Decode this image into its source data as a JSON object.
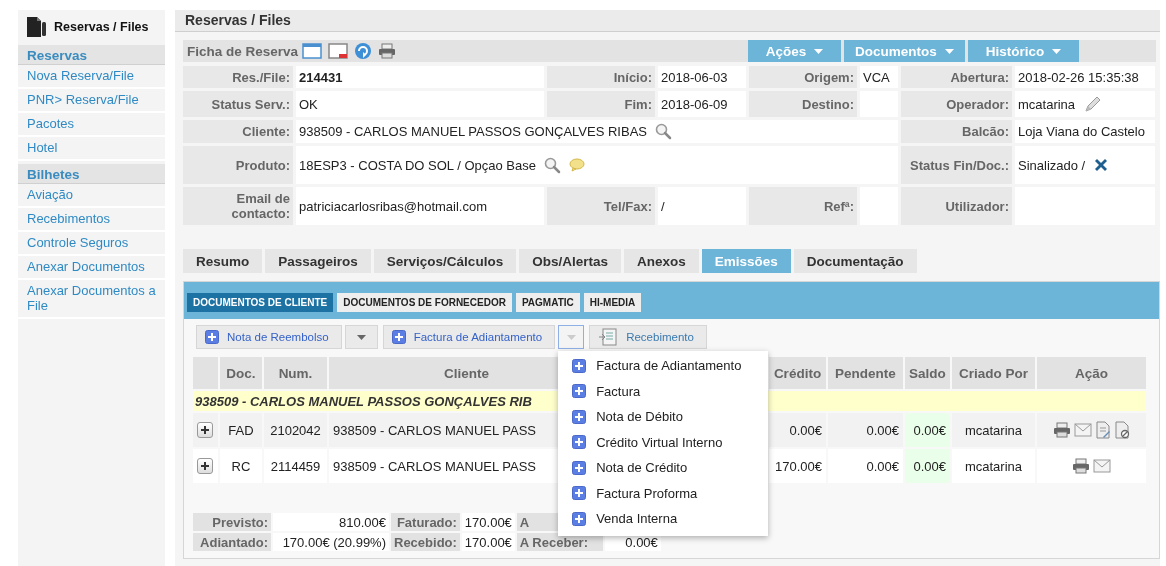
{
  "sidebar": {
    "title": "Reservas / Files",
    "sections": [
      {
        "title": "Reservas",
        "items": [
          "Nova Reserva/File",
          "PNR> Reserva/File",
          "Pacotes",
          "Hotel"
        ]
      },
      {
        "title": "Bilhetes",
        "items": [
          "Aviação",
          "Recebimentos",
          "Controle Seguros",
          "Anexar Documentos",
          "Anexar Documentos a File"
        ]
      }
    ]
  },
  "header": {
    "title": "Reservas / Files"
  },
  "ficha": {
    "title": "Ficha de Reserva",
    "menus": [
      "Ações",
      "Documentos",
      "Histórico"
    ]
  },
  "info": [
    [
      {
        "label": "Res./File:",
        "value": "214431",
        "kind": "key"
      },
      {
        "label": "Início:",
        "value": "2018-06-03",
        "kind": "plain"
      },
      {
        "label": "Origem:",
        "value": "VCA",
        "kind": "plain"
      },
      {
        "label": "Abertura:",
        "value": "2018-02-26 15:35:38",
        "kind": "plain"
      }
    ],
    [
      {
        "label": "Status Serv.:",
        "value": "OK",
        "kind": "plain"
      },
      {
        "label": "Fim:",
        "value": "2018-06-09",
        "kind": "plain"
      },
      {
        "label": "Destino:",
        "kind": "plain"
      },
      {
        "label": "Operador:",
        "value": "mcatarina",
        "kind": "plain"
      }
    ],
    [
      {
        "label": "Cliente:",
        "value": "938509 - CARLOS MANUEL PASSOS GONÇALVES RIBAS",
        "kind": "wide"
      },
      {
        "label": "Balcão:",
        "value": "Loja Viana do Castelo",
        "kind": "plain"
      }
    ],
    [
      {
        "label": "Produto:",
        "value": "18ESP3 - COSTA DO SOL / Opçao Base",
        "kind": "wide"
      },
      {
        "label": "Status Fin/Doc.:",
        "value": "Sinalizado  /",
        "kind": "plain"
      }
    ],
    [
      {
        "label": "Email de contacto:",
        "value": "patriciacarlosribas@hotmail.com",
        "kind": "plain"
      },
      {
        "label": "Tel/Fax:",
        "value": "/",
        "kind": "plain"
      },
      {
        "label": "Refª:",
        "kind": "plain"
      },
      {
        "label": "Utilizador:",
        "kind": "plain"
      }
    ]
  ],
  "tabs": [
    {
      "label": "Resumo",
      "selected": false
    },
    {
      "label": "Passageiros",
      "selected": false
    },
    {
      "label": "Serviços/Cálculos",
      "selected": false
    },
    {
      "label": "Obs/Alertas",
      "selected": false
    },
    {
      "label": "Anexos",
      "selected": false
    },
    {
      "label": "Emissões",
      "selected": true
    },
    {
      "label": "Documentação",
      "selected": false
    }
  ],
  "subtabs": [
    {
      "label": "DOCUMENTOS DE CLIENTE",
      "selected": true
    },
    {
      "label": "DOCUMENTOS DE FORNECEDOR",
      "selected": false
    },
    {
      "label": "PAGMATIC",
      "selected": false
    },
    {
      "label": "HI-MEDIA",
      "selected": false
    }
  ],
  "toolbar": [
    {
      "label": "Nota de Reembolso",
      "kind": "split",
      "open": false
    },
    {
      "label": "Factura de Adiantamento",
      "kind": "split",
      "open": true
    },
    {
      "label": "Recebimento",
      "kind": "plain"
    }
  ],
  "dropdown_menu": {
    "items": [
      "Factura de Adiantamento",
      "Factura",
      "Nota de Débito",
      "Crédito Virtual Interno",
      "Nota de Crédito",
      "Factura Proforma",
      "Venda Interna"
    ]
  },
  "table": {
    "columns": [
      "Doc.",
      "Num.",
      "Cliente",
      "Crédito",
      "Pendente",
      "Saldo",
      "Criado Por",
      "Ação"
    ],
    "group": "938509 - CARLOS MANUEL PASSOS GONÇALVES RIB",
    "rows": [
      {
        "expanded": false,
        "doc": "FAD",
        "num": "2102042",
        "cliente": "938509  - CARLOS MANUEL PASS",
        "credito": "0.00€",
        "pendente": "0.00€",
        "saldo": "0.00€",
        "criado_por": "mcatarina"
      },
      {
        "expanded": false,
        "doc": "RC",
        "num": "2114459",
        "cliente": "938509  - CARLOS MANUEL PASS",
        "credito": "170.00€",
        "pendente": "0.00€",
        "saldo": "0.00€",
        "criado_por": "mcatarina"
      }
    ]
  },
  "totals": [
    [
      {
        "label": "Previsto:",
        "value": "810.00€"
      },
      {
        "label": "Faturado:",
        "value": "170.00€"
      },
      {
        "label": "A"
      }
    ],
    [
      {
        "label": "Adiantado:",
        "value": "170.00€ (20.99%)"
      },
      {
        "label": "Recebido:",
        "value": "170.00€"
      },
      {
        "label": "A Receber:",
        "value": "0.00€"
      }
    ]
  ]
}
